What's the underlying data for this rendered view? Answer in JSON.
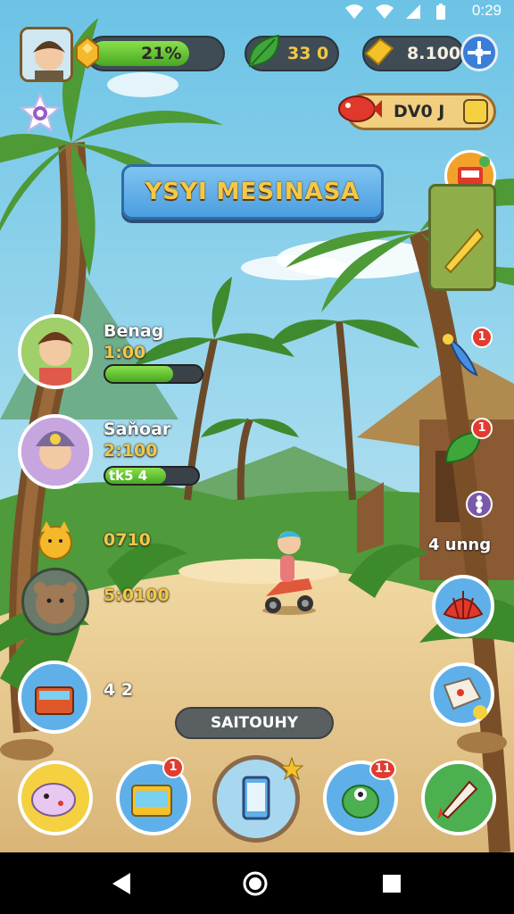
{
  "status_bar": {
    "time": "0:29"
  },
  "resources": {
    "xp_percent_label": "21%",
    "xp_fill_fraction": 0.21,
    "leaves_count": "33 0",
    "gold_count": "8.100"
  },
  "event_pill": {
    "label": "DV0 J"
  },
  "title": "YSYI MESINASA",
  "characters": [
    {
      "name": "Benag",
      "value": "1:00",
      "progress": 0.7
    },
    {
      "name": "Saňoar",
      "value": "2:100",
      "secondary": "tk5 4",
      "progress": 0.65
    }
  ],
  "side_stats": [
    {
      "value": "0710"
    },
    {
      "value": "5:0100"
    },
    {
      "value": "4 2"
    }
  ],
  "right_side": {
    "label": "4 unng"
  },
  "action_button": "SAITOUHY",
  "badges": {
    "right_1": "1",
    "right_2": "1",
    "bottom_chest": "1",
    "bottom_monster": "11"
  },
  "colors": {
    "sky": "#8fd0e8",
    "sand": "#e9c98c",
    "jungle": "#4f9a3a",
    "progress_green": "#6cc83a",
    "badge_red": "#e23b2f",
    "banner_blue": "#5aa8e8"
  }
}
